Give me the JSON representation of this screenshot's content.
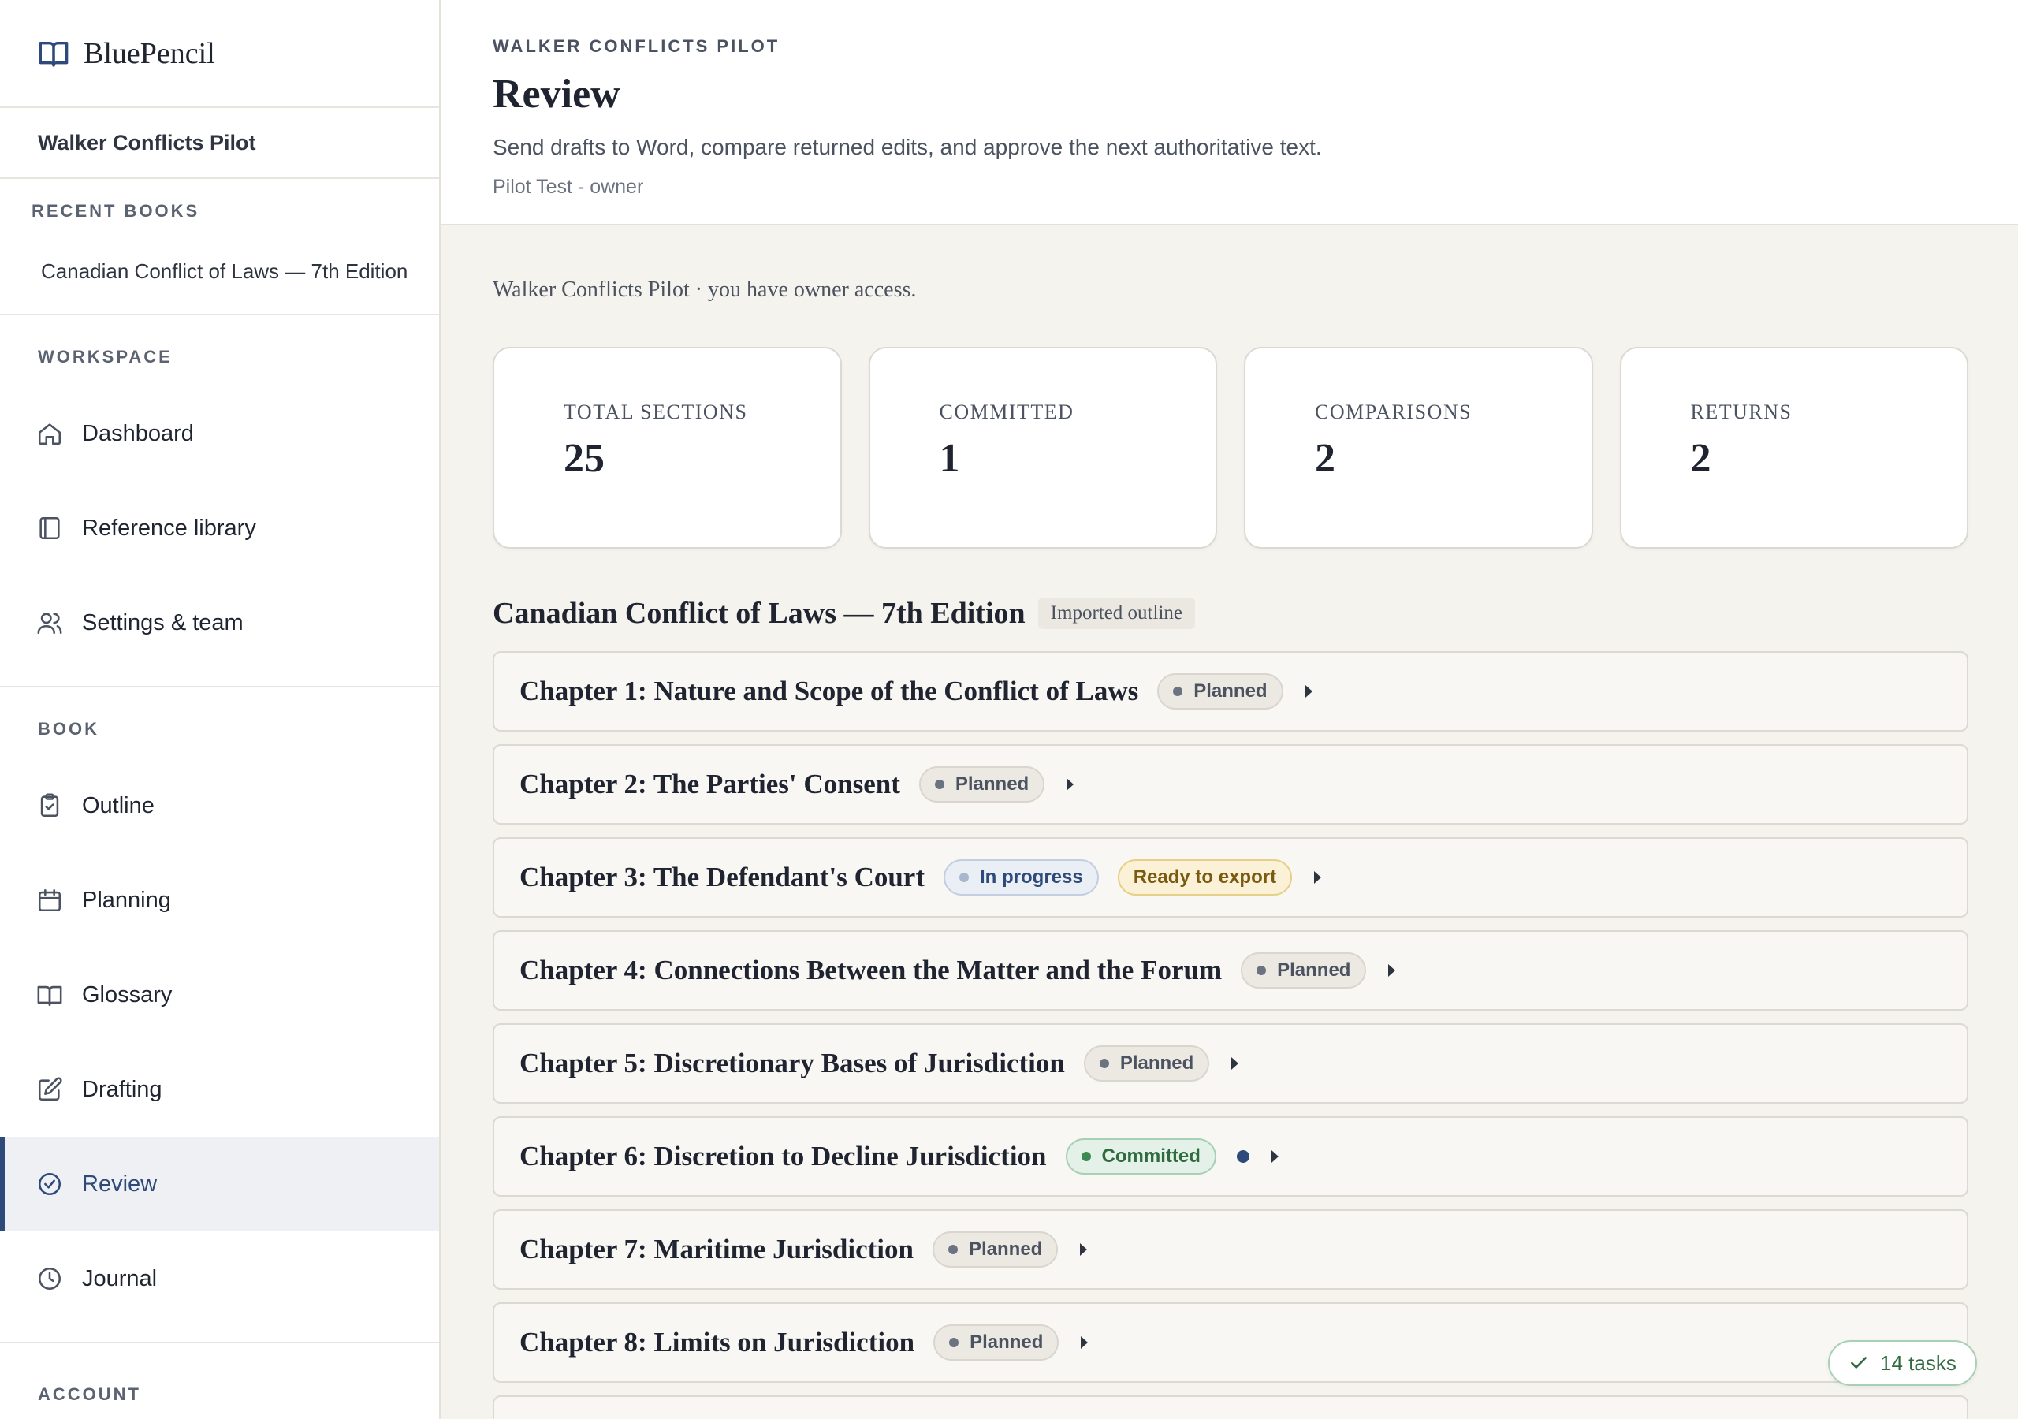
{
  "brand": {
    "name": "BluePencil"
  },
  "sidebar": {
    "project": "Walker Conflicts Pilot",
    "recent_label": "RECENT BOOKS",
    "recent_books": [
      "Canadian Conflict of Laws — 7th Edition"
    ],
    "workspace_label": "WORKSPACE",
    "workspace_items": [
      {
        "label": "Dashboard",
        "icon": "home-icon"
      },
      {
        "label": "Reference library",
        "icon": "book-icon"
      },
      {
        "label": "Settings & team",
        "icon": "users-icon"
      }
    ],
    "book_label": "BOOK",
    "book_items": [
      {
        "label": "Outline",
        "icon": "clipboard-icon"
      },
      {
        "label": "Planning",
        "icon": "calendar-icon"
      },
      {
        "label": "Glossary",
        "icon": "open-book-icon"
      },
      {
        "label": "Drafting",
        "icon": "edit-icon"
      },
      {
        "label": "Review",
        "icon": "check-circle-icon",
        "active": true
      },
      {
        "label": "Journal",
        "icon": "clock-icon"
      }
    ],
    "account_label": "ACCOUNT"
  },
  "header": {
    "eyebrow": "WALKER CONFLICTS PILOT",
    "title": "Review",
    "description": "Send drafts to Word, compare returned edits, and approve the next authoritative text.",
    "user": "Pilot Test - owner"
  },
  "access_line": "Walker Conflicts Pilot · you have owner access.",
  "stats": [
    {
      "label": "TOTAL SECTIONS",
      "value": "25"
    },
    {
      "label": "COMMITTED",
      "value": "1"
    },
    {
      "label": "COMPARISONS",
      "value": "2"
    },
    {
      "label": "RETURNS",
      "value": "2"
    }
  ],
  "book": {
    "title": "Canadian Conflict of Laws — 7th Edition",
    "badge": "Imported outline"
  },
  "chapters": [
    {
      "title": "Chapter 1: Nature and Scope of the Conflict of Laws",
      "status": "Planned"
    },
    {
      "title": "Chapter 2: The Parties' Consent",
      "status": "Planned"
    },
    {
      "title": "Chapter 3: The Defendant's Court",
      "status": "In progress",
      "extra": "Ready to export"
    },
    {
      "title": "Chapter 4: Connections Between the Matter and the Forum",
      "status": "Planned"
    },
    {
      "title": "Chapter 5: Discretionary Bases of Jurisdiction",
      "status": "Planned"
    },
    {
      "title": "Chapter 6: Discretion to Decline Jurisdiction",
      "status": "Committed",
      "dot": true
    },
    {
      "title": "Chapter 7: Maritime Jurisdiction",
      "status": "Planned"
    },
    {
      "title": "Chapter 8: Limits on Jurisdiction",
      "status": "Planned"
    }
  ],
  "tasks": {
    "label": "14 tasks"
  },
  "colors": {
    "accent": "#2d4a7a",
    "background": "#f5f3ee",
    "committed": "#2f6b3f",
    "export": "#7a5a10"
  }
}
